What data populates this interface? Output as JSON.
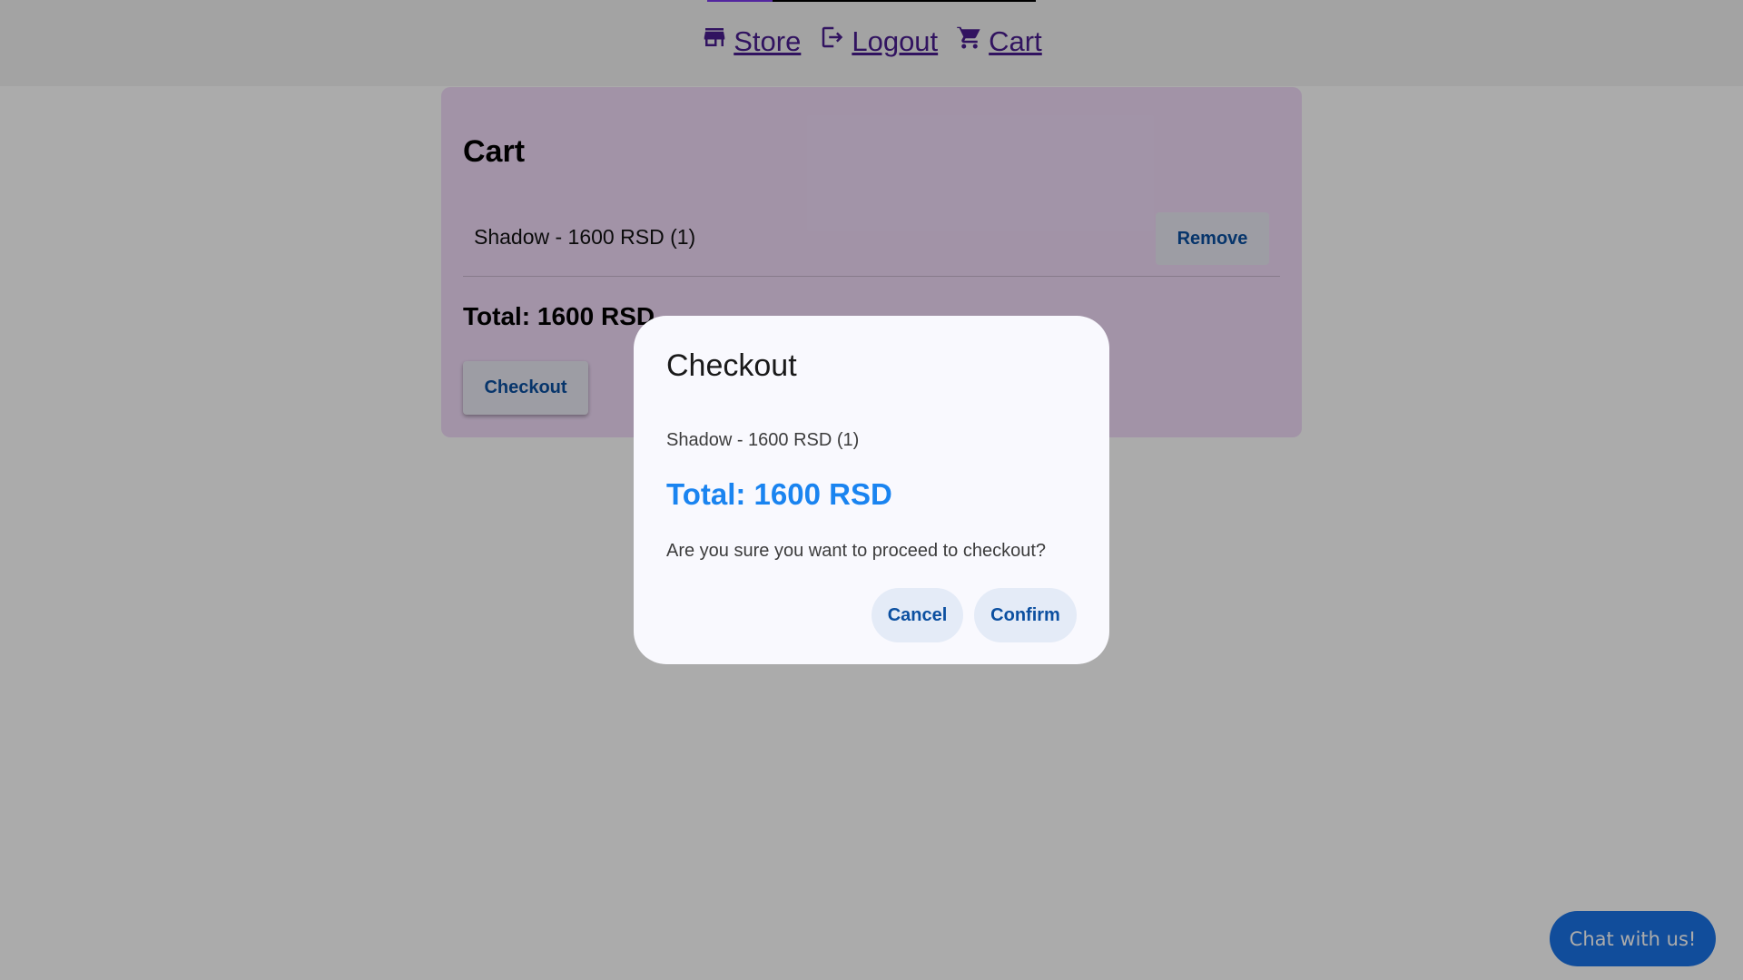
{
  "nav": {
    "progress_fraction": 0.2,
    "items": [
      {
        "label": "Store",
        "icon": "store-icon"
      },
      {
        "label": "Logout",
        "icon": "logout-icon"
      },
      {
        "label": "Cart",
        "icon": "cart-icon"
      }
    ]
  },
  "cart": {
    "title": "Cart",
    "item": "Shadow - 1600 RSD (1)",
    "remove_label": "Remove",
    "total": "Total: 1600 RSD",
    "checkout_label": "Checkout"
  },
  "dialog": {
    "title": "Checkout",
    "item": "Shadow - 1600 RSD (1)",
    "total": "Total: 1600 RSD",
    "question": "Are you sure you want to proceed to checkout?",
    "cancel_label": "Cancel",
    "confirm_label": "Confirm"
  },
  "chat": {
    "label": "Chat with us!"
  },
  "colors": {
    "accent": "#1a84f0",
    "nav_link": "#4a1d8f",
    "button_text": "#0b4fa0",
    "chat_button": "#1a73e8",
    "cart_card": "#f2dcfa"
  }
}
